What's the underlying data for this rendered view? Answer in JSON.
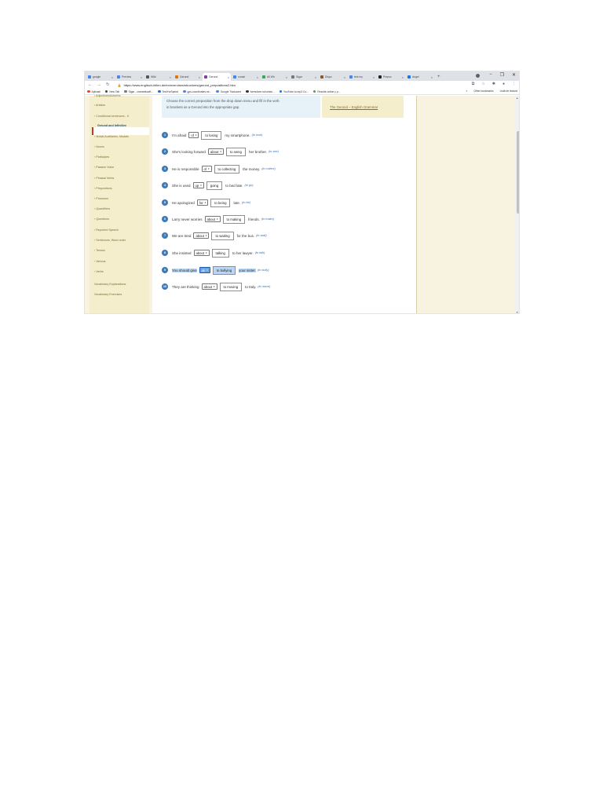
{
  "browser": {
    "tabs": [
      {
        "label": "google",
        "color": "#4285f4"
      },
      {
        "label": "Preview",
        "color": "#4285f4"
      },
      {
        "label": "Wikt",
        "color": "#555555"
      },
      {
        "label": "Gerund",
        "color": "#e37400"
      },
      {
        "label": "Gerund",
        "color": "#7b3fa0",
        "active": true
      },
      {
        "label": "constr",
        "color": "#4285f4"
      },
      {
        "label": "All Wh",
        "color": "#34a853"
      },
      {
        "label": "Sigar",
        "color": "#777777"
      },
      {
        "label": "Dispo",
        "color": "#8a5a2b"
      },
      {
        "label": "text my",
        "color": "#4285f4"
      },
      {
        "label": "Prepoz",
        "color": "#222222"
      },
      {
        "label": "Angel",
        "color": "#1a73e8"
      }
    ],
    "new_tab": "+",
    "window_controls": [
      "−",
      "❐",
      "✕"
    ],
    "url": "https://www.englisch-hilfen.de/en/exercises/structures/gerund_prepositions2.htm",
    "bookmarks": [
      {
        "label": "Aplicații",
        "color": "#e94235"
      },
      {
        "label": "New Tab",
        "color": "#444444"
      },
      {
        "label": "Sigar - crameatowft...",
        "color": "#777777"
      },
      {
        "label": "TestYurSpeed",
        "color": "#1a73e8"
      },
      {
        "label": "gps-coordinates.ne...",
        "color": "#4285f4"
      },
      {
        "label": "Google Traducere",
        "color": "#4285f4"
      },
      {
        "label": "formulare.ro/comisi...",
        "color": "#333333"
      },
      {
        "label": "YouTube to mp3 Co...",
        "color": "#1a73e8"
      },
      {
        "label": "Rezulte online y p...",
        "color": "#34a853"
      }
    ],
    "bookmarks_more": "»",
    "other_bookmarks": "Other bookmarks",
    "reading_list": "Listă de lectură"
  },
  "sidebar": {
    "items": [
      "› Adjectives/Adverbs",
      "› Articles",
      "› Conditional sentences - if",
      "Gerund and Infinitive",
      "› Modal Auxiliaries, Modals",
      "› Nouns",
      "› Participles",
      "› Passive Voice",
      "› Phrasal Verbs",
      "› Prepositions",
      "› Pronouns",
      "› Quantifiers",
      "› Questions",
      "› Reported Speech",
      "› Sentences, Word order",
      "› Tenses",
      "› Various",
      "› Verbs",
      "Vocabulary Explanations",
      "Vocabulary Exercises"
    ],
    "active_index": 3
  },
  "instructions": {
    "line1": "Choose the correct preposition from the drop down menu and fill in the verb",
    "line2": "in brackets as a Gerund into the appropriate gap."
  },
  "info_link": "The Gerund – English Grammar",
  "exercises": [
    {
      "num": "1",
      "before": "I'm afraid",
      "prep": "of",
      "answer": "to losing",
      "after": "my smartphone.",
      "hint": "(to lose)"
    },
    {
      "num": "2",
      "before": "She's looking forward",
      "prep": "about",
      "answer": "to seing",
      "after": "her brother.",
      "hint": "(to see)"
    },
    {
      "num": "3",
      "before": "He is responsible",
      "prep": "of",
      "answer": "to collecting",
      "after": "the money.",
      "hint": "(to collect)"
    },
    {
      "num": "4",
      "before": "She is used",
      "prep": "up",
      "answer": "going",
      "after": "to bed late.",
      "hint": "(to go)"
    },
    {
      "num": "5",
      "before": "He apologized",
      "prep": "for",
      "answer": "to being",
      "after": "late.",
      "hint": "(to be)"
    },
    {
      "num": "6",
      "before": "Larry never worries",
      "prep": "about",
      "answer": "to making",
      "after": "friends.",
      "hint": "(to make)"
    },
    {
      "num": "7",
      "before": "We are tired",
      "prep": "about",
      "answer": "to waiting",
      "after": "for the bus.",
      "hint": "(to wait)"
    },
    {
      "num": "8",
      "before": "She insisted",
      "prep": "about",
      "answer": "talking",
      "after": "to her lawyer.",
      "hint": "(to talk)"
    },
    {
      "num": "9",
      "before": "You should give",
      "prep": "on",
      "answer": "to bullying",
      "after": "your sister.",
      "hint": "(to bully)",
      "highlight": true
    },
    {
      "num": "10",
      "before": "They are thinking",
      "prep": "about",
      "answer": "to moving",
      "after": "to Italy.",
      "hint": "(to move)"
    }
  ]
}
